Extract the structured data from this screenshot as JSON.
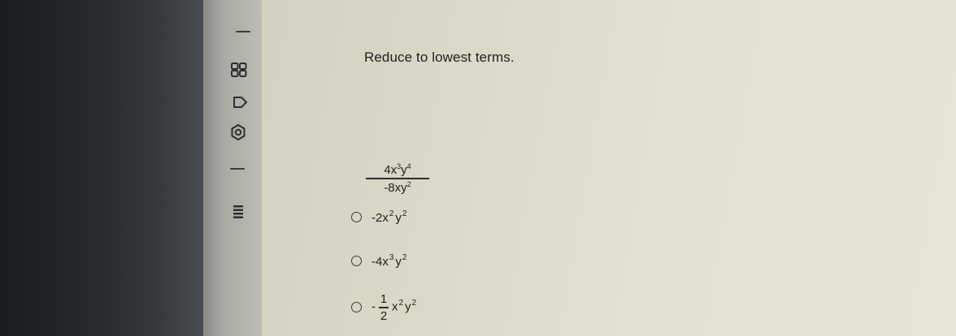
{
  "question": {
    "prompt": "Reduce to lowest terms.",
    "expression": {
      "numerator": {
        "coef": "4x",
        "x_exp": "3",
        "var2": "y",
        "y_exp": "4"
      },
      "denominator": {
        "coef": "-8xy",
        "y_exp": "2"
      }
    }
  },
  "options": [
    {
      "base": "-2x",
      "x_exp": "2",
      "var2": "y",
      "y_exp": "2"
    },
    {
      "base": "-4x",
      "x_exp": "3",
      "var2": "y",
      "y_exp": "2"
    },
    {
      "sign": "-",
      "frac_num": "1",
      "frac_den": "2",
      "base": "x",
      "x_exp": "2",
      "var2": "y",
      "y_exp": "2"
    }
  ],
  "rail_icons": [
    "grid-icon",
    "tag-icon",
    "settings-icon",
    "menu-icon"
  ]
}
